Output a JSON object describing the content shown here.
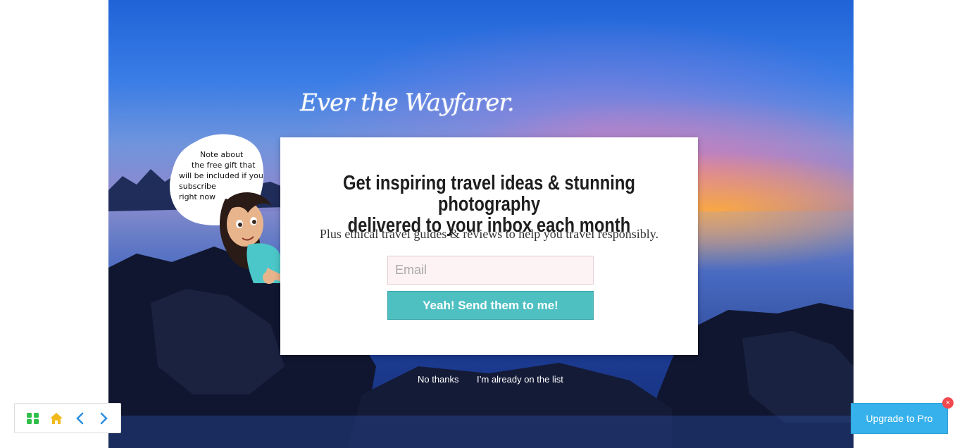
{
  "logo": {
    "text": "Ever the Wayfarer."
  },
  "popup": {
    "headline_line1": "Get inspiring travel ideas & stunning photography",
    "headline_line2": "delivered to your inbox each month",
    "subline": "Plus ethical travel guides & reviews to help you travel responsibly.",
    "email_placeholder": "Email",
    "submit_label": "Yeah! Send them to me!"
  },
  "links": {
    "no_thanks": "No thanks",
    "already": "I’m already on the list"
  },
  "bubble": {
    "lines": [
      "Note about",
      "the free gift that",
      "will be included if you",
      "subscribe",
      "right now"
    ]
  },
  "toolbar": {
    "icons": [
      "grid-icon",
      "home-icon",
      "chevron-left-icon",
      "chevron-right-icon"
    ]
  },
  "upgrade": {
    "label": "Upgrade to Pro",
    "close": "×"
  },
  "colors": {
    "button": "#4fc0c2",
    "upgrade": "#36b1ec",
    "close": "#f0484e"
  }
}
